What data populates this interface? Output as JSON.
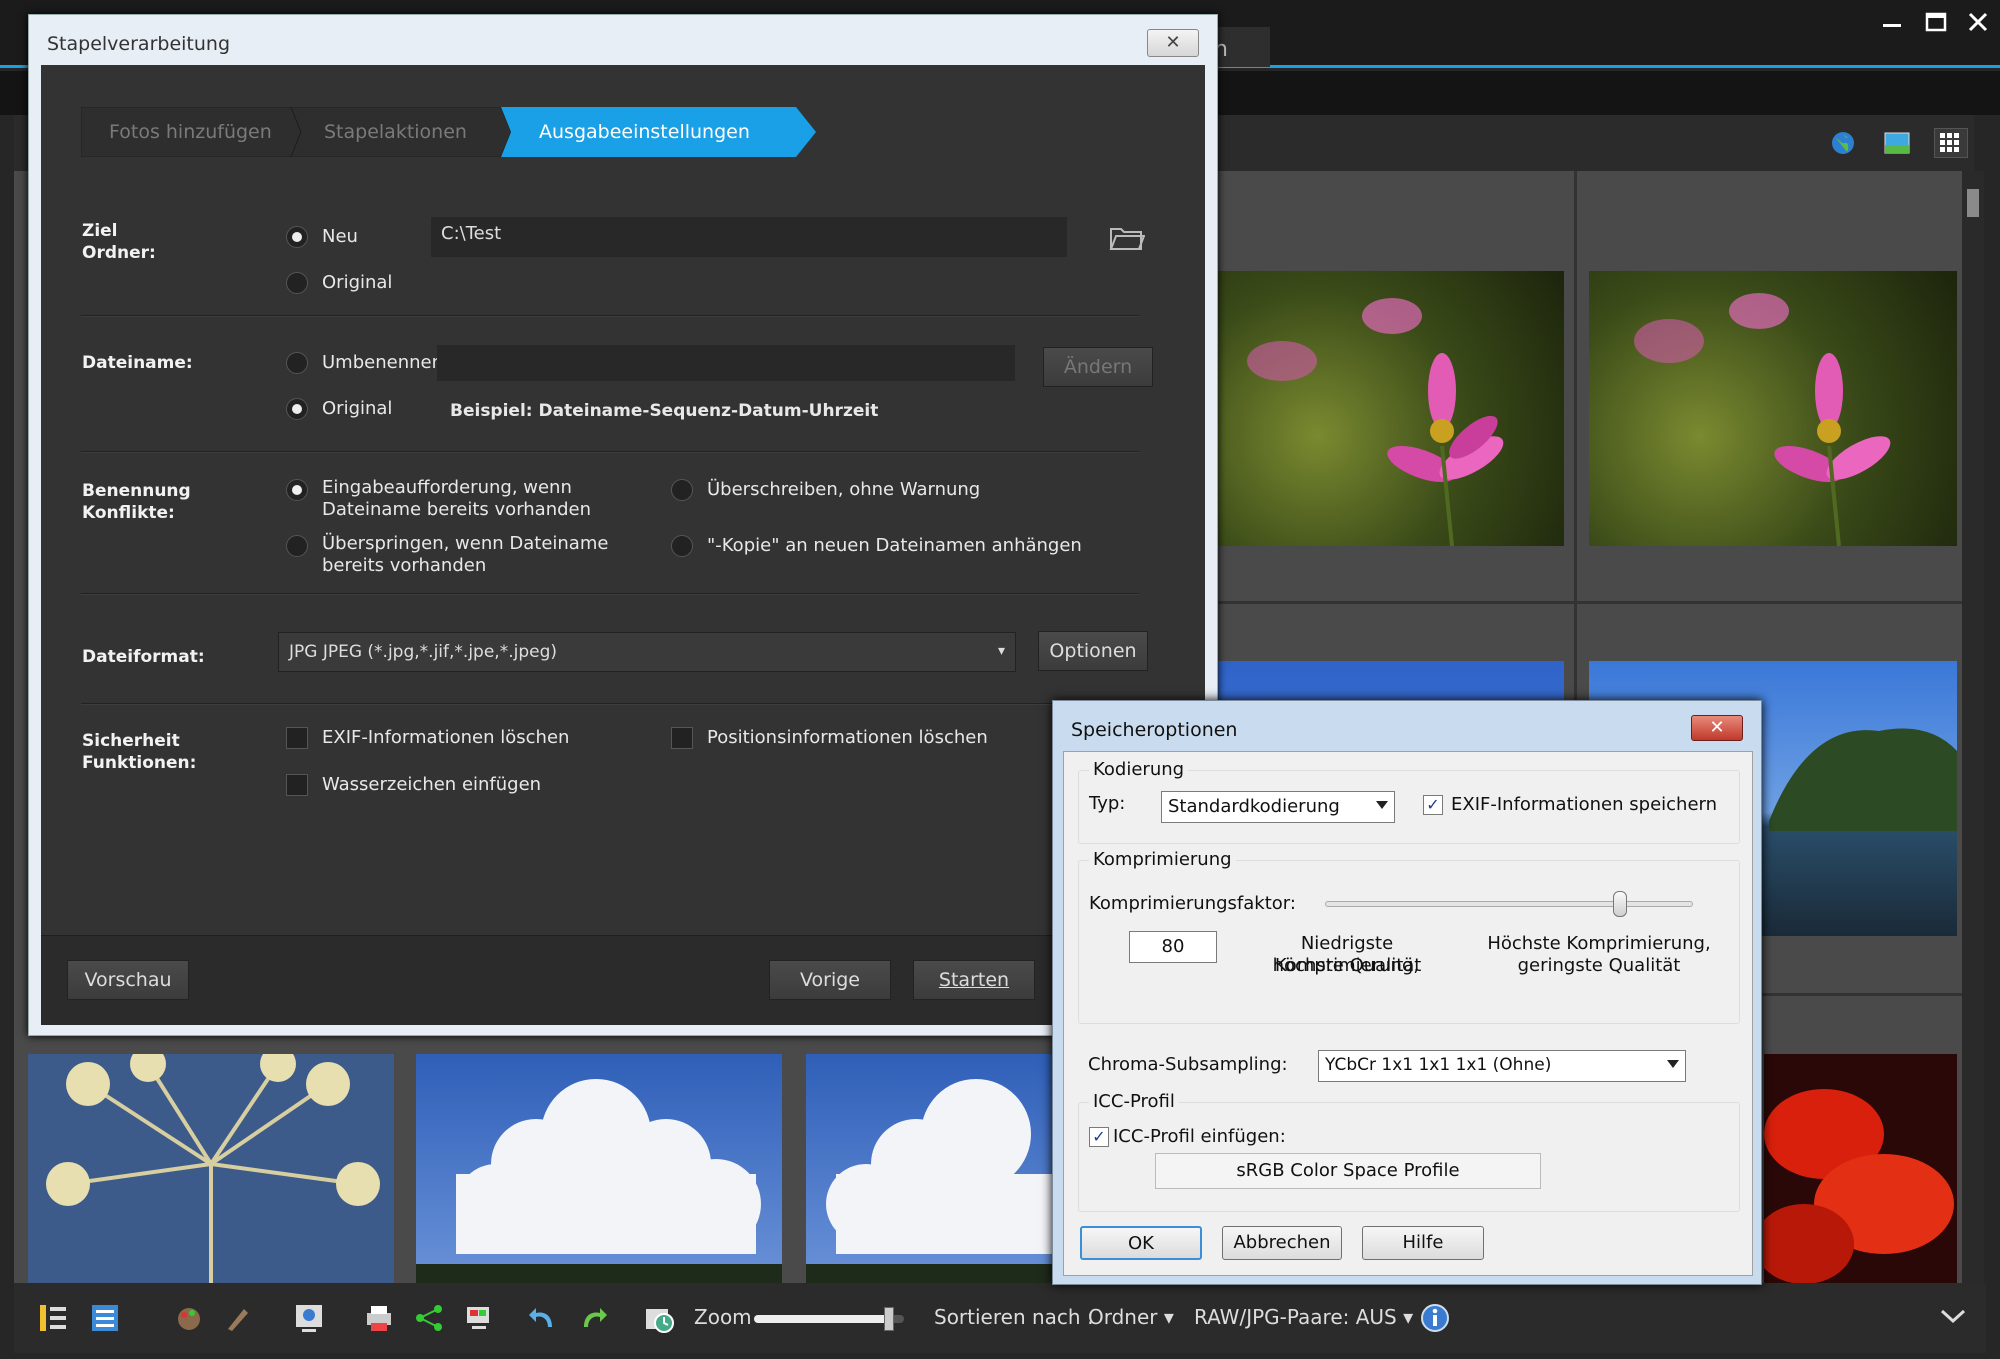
{
  "app": {
    "tab_partial": "n",
    "window_controls": [
      "minimize-icon",
      "maximize-icon",
      "close-icon"
    ],
    "toolbar_icons": [
      "globe-icon",
      "map-icon",
      "grid-view-icon"
    ]
  },
  "bottombar": {
    "zoom_label": "Zoom",
    "sort_label": "Sortieren nach :",
    "sort_value": "Ordner",
    "raw_jpg_label": "RAW/JPG-Paare: AUS",
    "info_icon": "info-icon",
    "zoom_level": 0.9
  },
  "batch_dialog": {
    "title": "Stapelverarbeitung",
    "close_symbol": "✕",
    "steps": [
      "Fotos hinzufügen",
      "Stapelaktionen",
      "Ausgabeeinstellungen"
    ],
    "active_step": 2,
    "target": {
      "label_line1": "Ziel",
      "label_line2": "Ordner:",
      "option_new": "Neu",
      "option_original": "Original",
      "path": "C:\\Test"
    },
    "filename": {
      "label": "Dateiname:",
      "option_rename": "Umbenennen",
      "option_original": "Original",
      "change_button": "Ändern",
      "example": "Beispiel: Dateiname-Sequenz-Datum-Uhrzeit"
    },
    "conflicts": {
      "label_line1": "Benennung",
      "label_line2": "Konflikte:",
      "prompt_line1": "Eingabeaufforderung, wenn",
      "prompt_line2": "Dateiname bereits vorhanden",
      "overwrite": "Überschreiben, ohne Warnung",
      "skip_line1": "Überspringen, wenn Dateiname",
      "skip_line2": "bereits vorhanden",
      "append_copy": "\"-Kopie\" an neuen Dateinamen anhängen"
    },
    "format": {
      "label": "Dateiformat:",
      "value": "JPG JPEG  (*.jpg,*.jif,*.jpe,*.jpeg)",
      "options_button": "Optionen"
    },
    "security": {
      "label_line1": "Sicherheit",
      "label_line2": "Funktionen:",
      "delete_exif": "EXIF-Informationen löschen",
      "delete_position": "Positionsinformationen löschen",
      "watermark": "Wasserzeichen einfügen"
    },
    "footer": {
      "preview": "Vorschau",
      "previous": "Vorige",
      "start": "Starten"
    }
  },
  "save_options": {
    "title": "Speicheroptionen",
    "close_symbol": "✕",
    "encoding_group": "Kodierung",
    "type_label": "Typ:",
    "type_value": "Standardkodierung",
    "save_exif": "EXIF-Informationen speichern",
    "save_exif_checked": true,
    "compression_group": "Komprimierung",
    "compression_factor_label": "Komprimierungsfaktor:",
    "compression_value": "80",
    "compression_fraction": 0.8,
    "low_line1": "Niedrigste Komprimierung,",
    "low_line2": "höchste Qualität",
    "high_line1": "Höchste Komprimierung,",
    "high_line2": "geringste Qualität",
    "chroma_label": "Chroma-Subsampling:",
    "chroma_value": "YCbCr  1x1  1x1  1x1  (Ohne)",
    "icc_group": "ICC-Profil",
    "icc_embed": "ICC-Profil einfügen:",
    "icc_checked": true,
    "icc_profile": "sRGB Color Space Profile",
    "ok": "OK",
    "cancel": "Abbrechen",
    "help": "Hilfe"
  }
}
